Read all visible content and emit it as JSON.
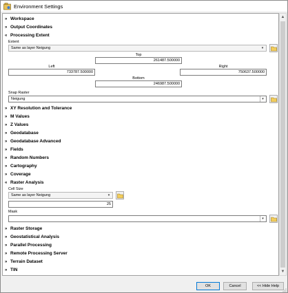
{
  "window": {
    "title": "Environment Settings"
  },
  "sections": {
    "workspace": "Workspace",
    "output_coordinates": "Output Coordinates",
    "processing_extent": "Processing Extent",
    "xy_resolution": "XY Resolution and Tolerance",
    "m_values": "M Values",
    "z_values": "Z Values",
    "geodatabase": "Geodatabase",
    "geodatabase_advanced": "Geodatabase Advanced",
    "fields": "Fields",
    "random_numbers": "Random Numbers",
    "cartography": "Cartography",
    "coverage": "Coverage",
    "raster_analysis": "Raster Analysis",
    "raster_storage": "Raster Storage",
    "geostatistical_analysis": "Geostatistical Analysis",
    "parallel_processing": "Parallel Processing",
    "remote_processing_server": "Remote Processing Server",
    "terrain_dataset": "Terrain Dataset",
    "tin": "TIN"
  },
  "processing_extent": {
    "extent_label": "Extent",
    "extent_value": "Same as layer Neigung",
    "top_label": "Top",
    "top_value": "261487.500000",
    "left_label": "Left",
    "left_value": "733787.500000",
    "right_label": "Right",
    "right_value": "750637.500000",
    "bottom_label": "Bottom",
    "bottom_value": "246987.500000",
    "snap_label": "Snap Raster",
    "snap_value": "Neigung"
  },
  "raster_analysis": {
    "cell_size_label": "Cell Size",
    "cell_size_mode": "Same as layer Neigung",
    "cell_size_value": "25",
    "mask_label": "Mask",
    "mask_value": ""
  },
  "buttons": {
    "ok": "OK",
    "cancel": "Cancel",
    "hide_help": "<< Hide Help"
  },
  "icons": {
    "expanded": "chevron-up-double-icon",
    "collapsed": "chevron-down-double-icon",
    "browse": "folder-icon"
  }
}
